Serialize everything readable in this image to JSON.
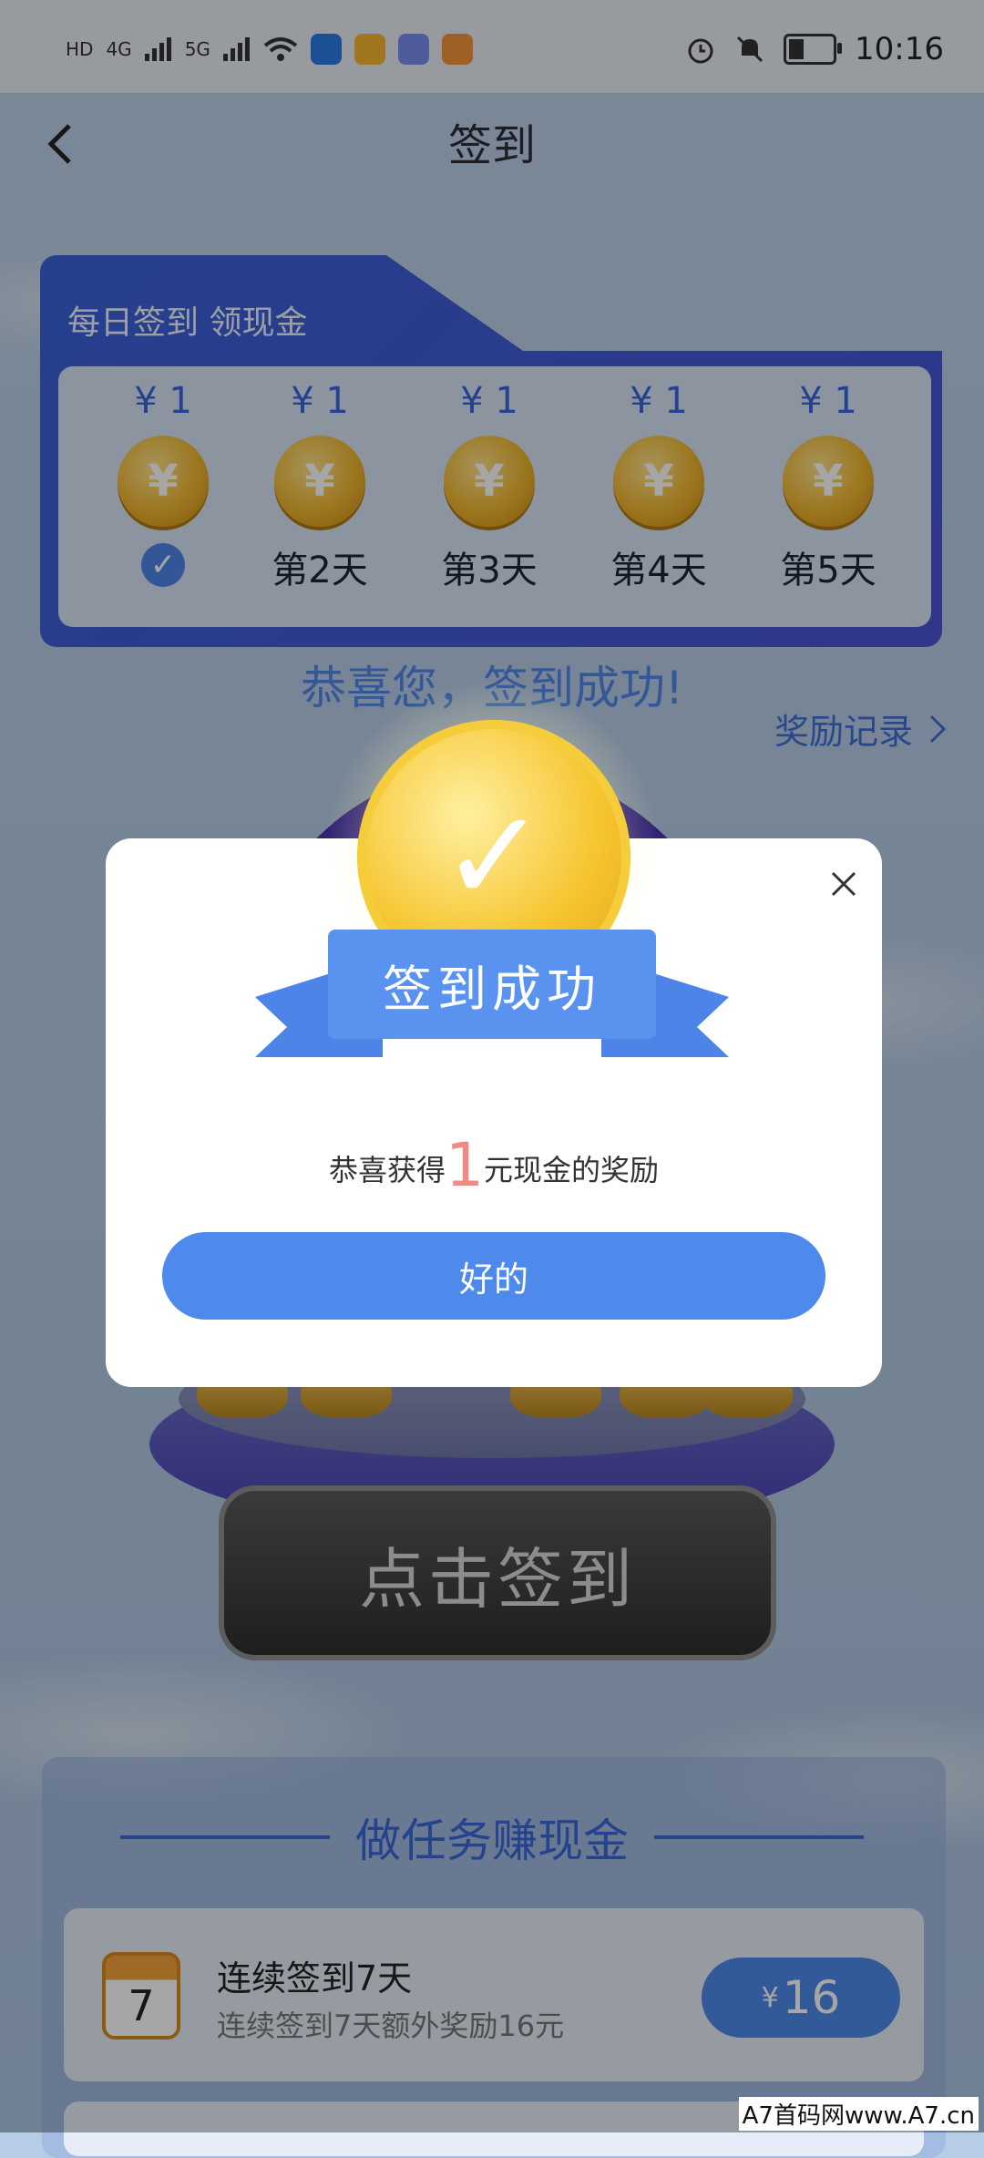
{
  "status_bar": {
    "left_text": [
      "HD",
      "4G",
      "5G"
    ],
    "time": "10:16",
    "battery_level": 0.3,
    "app_colors": [
      "#2c7be5",
      "#f6b531",
      "#7b8cf0",
      "#f5943b"
    ]
  },
  "header": {
    "title": "签到"
  },
  "checkin_card": {
    "title": "每日签到 领现金",
    "days": [
      {
        "amount": "¥ 1",
        "label": "",
        "checked": true
      },
      {
        "amount": "¥ 1",
        "label": "第2天",
        "checked": false
      },
      {
        "amount": "¥ 1",
        "label": "第3天",
        "checked": false
      },
      {
        "amount": "¥ 1",
        "label": "第4天",
        "checked": false
      },
      {
        "amount": "¥ 1",
        "label": "第5天",
        "checked": false
      }
    ]
  },
  "congrats_text": "恭喜您，签到成功!",
  "reward_record_link": "奖励记录",
  "sign_button": "点击签到",
  "dialog": {
    "ribbon_text": "签到成功",
    "reward_prefix": "恭喜获得",
    "reward_amount": "1",
    "reward_suffix": "元现金的奖励",
    "ok_button": "好的"
  },
  "tasks": {
    "title": "做任务赚现金",
    "items": [
      {
        "icon": "calendar-icon",
        "icon_text": "7",
        "title": "连续签到7天",
        "subtitle": "连续签到7天额外奖励16元",
        "currency": "¥",
        "reward": "16"
      }
    ]
  },
  "watermark": "A7首码网www.A7.cn",
  "colors": {
    "accent": "#4d8aec",
    "card": "#3a63d9",
    "highlight": "#f08a84"
  }
}
